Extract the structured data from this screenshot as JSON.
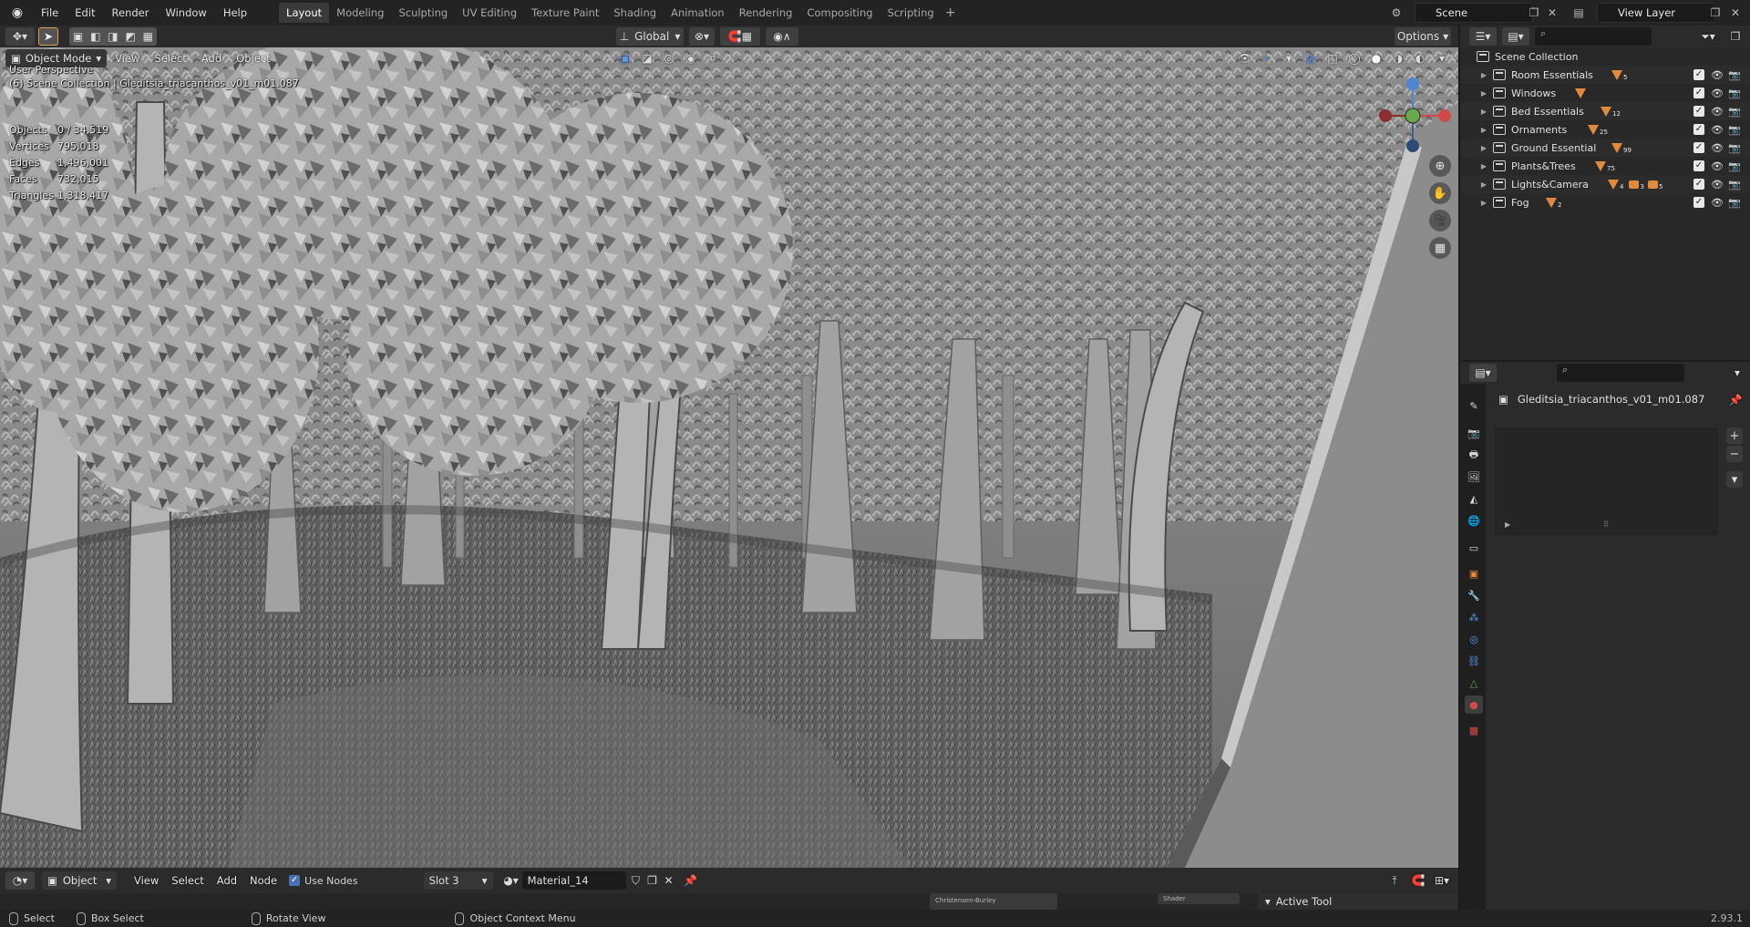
{
  "topbar": {
    "menus": [
      "File",
      "Edit",
      "Render",
      "Window",
      "Help"
    ],
    "workspaces": [
      "Layout",
      "Modeling",
      "Sculpting",
      "UV Editing",
      "Texture Paint",
      "Shading",
      "Animation",
      "Rendering",
      "Compositing",
      "Scripting"
    ],
    "active_workspace": "Layout",
    "scene_name": "Scene",
    "view_layer": "View Layer"
  },
  "viewport": {
    "mode": "Object Mode",
    "menus": [
      "View",
      "Select",
      "Add",
      "Object"
    ],
    "transform_orientation": "Global",
    "options_label": "Options",
    "perspective_label": "User Perspective",
    "context_label": "(6) Scene Collection | Gleditsia_triacanthos_v01_m01.087",
    "stats": [
      {
        "label": "Objects",
        "value": "0 / 34,519"
      },
      {
        "label": "Vertices",
        "value": "795,018"
      },
      {
        "label": "Edges",
        "value": "1,496,001"
      },
      {
        "label": "Faces",
        "value": "732,015"
      },
      {
        "label": "Triangles",
        "value": "1,318,417"
      }
    ]
  },
  "outliner": {
    "root": "Scene Collection",
    "collections": [
      {
        "name": "Room Essentials",
        "badge": "5"
      },
      {
        "name": "Windows",
        "badge": ""
      },
      {
        "name": "Bed Essentials",
        "badge": "12"
      },
      {
        "name": "Ornaments",
        "badge": "25"
      },
      {
        "name": "Ground Essential",
        "badge": "99"
      },
      {
        "name": "Plants&Trees",
        "badge": "75"
      },
      {
        "name": "Lights&Camera",
        "badge": "4",
        "badge2": "3",
        "badge3": "5"
      },
      {
        "name": "Fog",
        "badge": "2"
      }
    ]
  },
  "properties": {
    "object_name": "Gleditsia_triacanthos_v01_m01.087"
  },
  "node_editor": {
    "object_type": "Object",
    "menus": [
      "View",
      "Select",
      "Add",
      "Node"
    ],
    "use_nodes_label": "Use Nodes",
    "slot": "Slot 3",
    "material": "Material_14",
    "active_tool_label": "Active Tool",
    "node_bsdf_label": "Christensen-Burley",
    "node_shader_label": "Shader"
  },
  "statusbar": {
    "select": "Select",
    "box_select": "Box Select",
    "rotate_view": "Rotate View",
    "context_menu": "Object Context Menu",
    "version": "2.93.1"
  }
}
